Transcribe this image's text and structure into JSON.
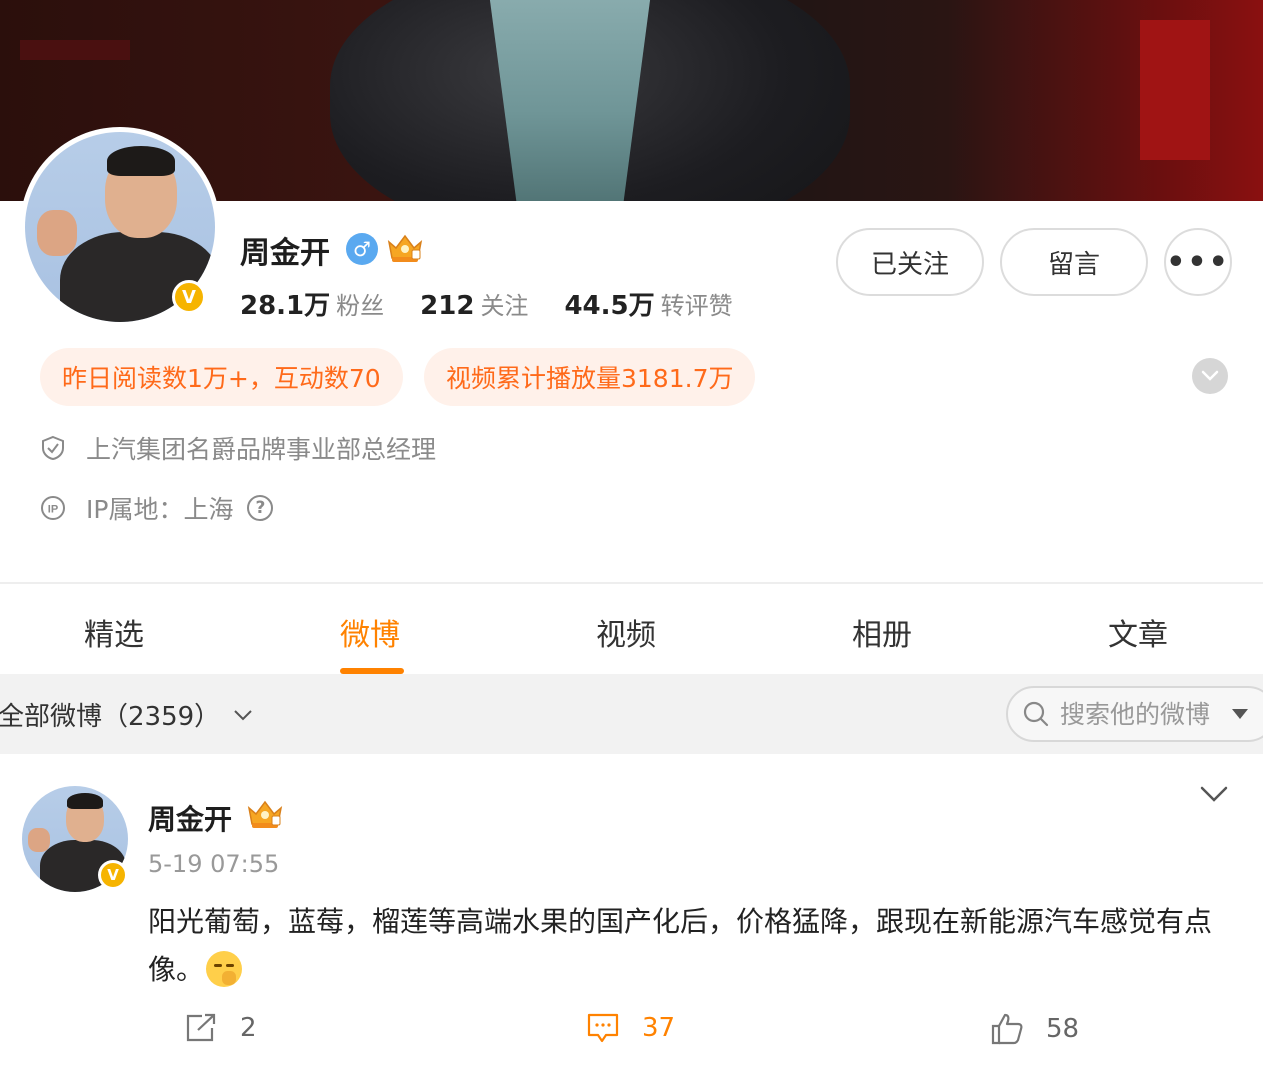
{
  "profile": {
    "name": "周金开",
    "gender_icon": "♂",
    "stats": [
      {
        "value": "28.1万",
        "label": "粉丝"
      },
      {
        "value": "212",
        "label": "关注"
      },
      {
        "value": "44.5万",
        "label": "转评赞"
      }
    ],
    "buttons": {
      "follow": "已关注",
      "message": "留言",
      "more": "•••"
    },
    "tags": [
      "昨日阅读数1万+，互动数70",
      "视频累计播放量3181.7万"
    ],
    "verification": "上汽集团名爵品牌事业部总经理",
    "ip_location": "IP属地：上海",
    "verified_badge": "V"
  },
  "tabs": [
    "精选",
    "微博",
    "视频",
    "相册",
    "文章"
  ],
  "active_tab": "微博",
  "filter": {
    "label": "全部微博（2359）",
    "search_placeholder": "搜索他的微博"
  },
  "post": {
    "author": "周金开",
    "time": "5-19 07:55",
    "text": "阳光葡萄，蓝莓，榴莲等高端水果的国产化后，价格猛降，跟现在新能源汽车感觉有点像。",
    "reposts": "2",
    "comments": "37",
    "likes": "58"
  },
  "colors": {
    "accent": "#ff8200",
    "tag_text": "#ff6a1a",
    "tag_bg": "#fff1ea",
    "verified": "#f6b400",
    "gender": "#5aa9f0"
  },
  "icons": [
    "shield-check-icon",
    "ip-icon",
    "question-icon",
    "search-icon",
    "chevron-down-icon",
    "repost-icon",
    "comment-icon",
    "like-icon",
    "crown-icon"
  ]
}
